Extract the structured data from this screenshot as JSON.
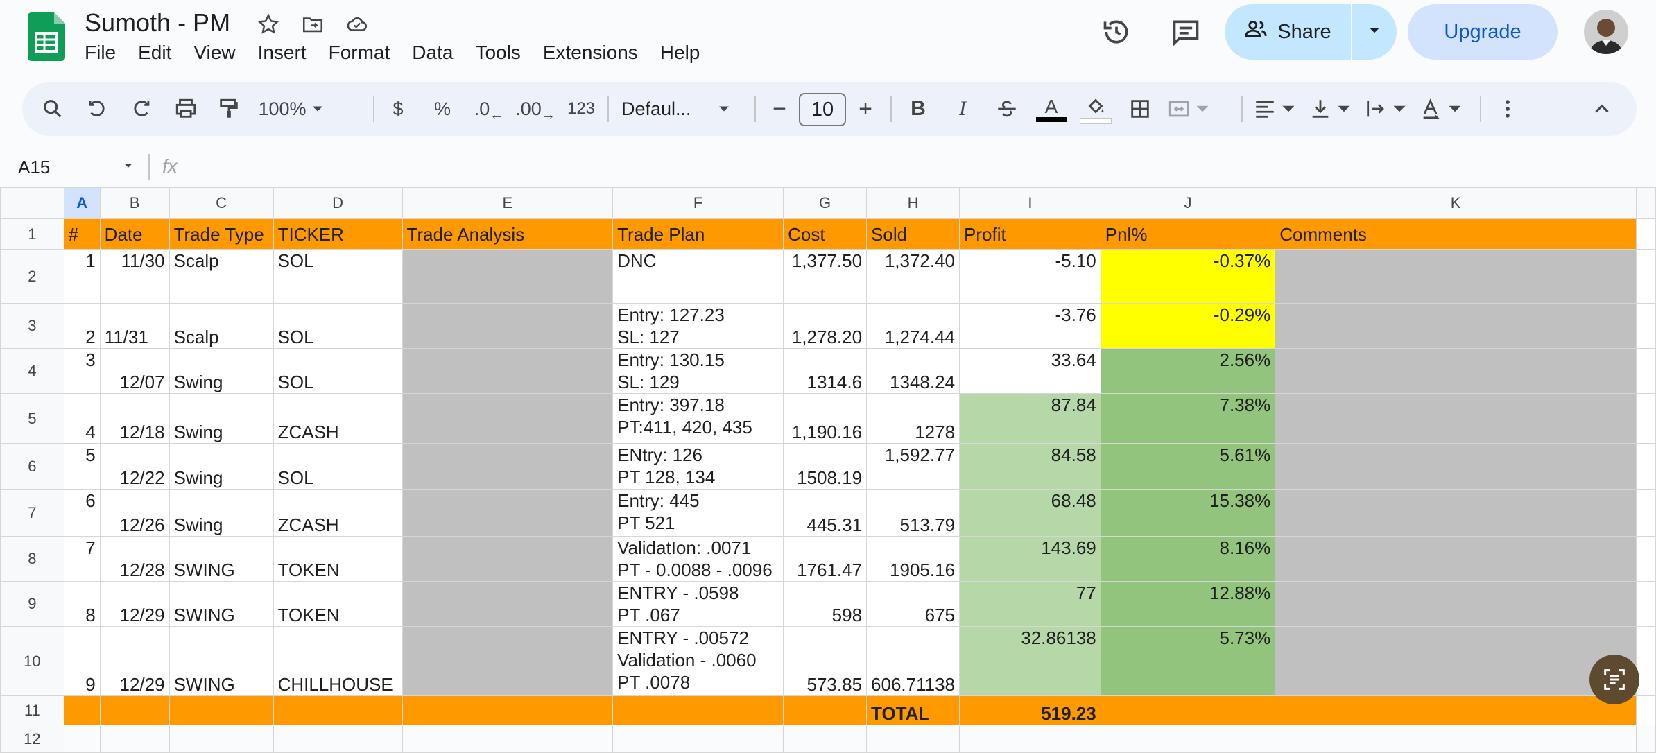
{
  "app": {
    "doc_title": "Sumoth - PM",
    "menu": [
      "File",
      "Edit",
      "View",
      "Insert",
      "Format",
      "Data",
      "Tools",
      "Extensions",
      "Help"
    ],
    "share_label": "Share",
    "upgrade_label": "Upgrade"
  },
  "toolbar": {
    "zoom": "100%",
    "currency": "$",
    "percent": "%",
    "dec_decrease": ".0",
    "dec_increase": ".00",
    "number_format": "123",
    "font": "Defaul...",
    "font_size": "10",
    "bold": "B",
    "italic": "I",
    "text_color": "A"
  },
  "formula_bar": {
    "name_box": "A15",
    "fx": "fx",
    "value": ""
  },
  "columns": [
    "A",
    "B",
    "C",
    "D",
    "E",
    "F",
    "G",
    "H",
    "I",
    "J",
    "K"
  ],
  "row_numbers": [
    "1",
    "2",
    "3",
    "4",
    "5",
    "6",
    "7",
    "8",
    "9",
    "10",
    "11",
    "12"
  ],
  "header": {
    "a": "#",
    "b": "Date",
    "c": "Trade Type",
    "d": "TICKER",
    "e": "Trade Analysis",
    "f": "Trade Plan",
    "g": "Cost",
    "h": "Sold",
    "i": "Profit",
    "j": "Pnl%",
    "k": "Comments"
  },
  "rows": [
    {
      "a": "1",
      "b": "11/30",
      "c": "Scalp",
      "d": "SOL",
      "f": [
        "DNC"
      ],
      "g": "1,377.50",
      "h": "1,372.40",
      "i": "-5.10",
      "j": "-0.37%"
    },
    {
      "a": "2",
      "b": "11/31",
      "c": "Scalp",
      "d": "SOL",
      "f": [
        "Entry:  127.23",
        "SL: 127"
      ],
      "g": "1,278.20",
      "h": "1,274.44",
      "i": "-3.76",
      "j": "-0.29%"
    },
    {
      "a": "3",
      "b": "12/07",
      "c": "Swing",
      "d": "SOL",
      "f": [
        "Entry: 130.15",
        "SL: 129"
      ],
      "g": "1314.6",
      "h": "1348.24",
      "i": "33.64",
      "j": "2.56%"
    },
    {
      "a": "4",
      "b": "12/18",
      "c": "Swing",
      "d": "ZCASH",
      "f": [
        "Entry: 397.18",
        "PT:411, 420, 435"
      ],
      "g": "1,190.16",
      "h": "1278",
      "i": "87.84",
      "j": "7.38%"
    },
    {
      "a": "5",
      "b": "12/22",
      "c": "Swing",
      "d": "SOL",
      "f": [
        "ENtry: 126",
        "PT 128, 134"
      ],
      "g": "1508.19",
      "h": "1,592.77",
      "i": "84.58",
      "j": "5.61%"
    },
    {
      "a": "6",
      "b": "12/26",
      "c": "Swing",
      "d": "ZCASH",
      "f": [
        "Entry: 445",
        "PT 521"
      ],
      "g": "445.31",
      "h": "513.79",
      "i": "68.48",
      "j": "15.38%"
    },
    {
      "a": "7",
      "b": "12/28",
      "c": "SWING",
      "d": "TOKEN",
      "f": [
        "ValidatIon: .0071",
        "PT - 0.0088 - .0096"
      ],
      "g": "1761.47",
      "h": "1905.16",
      "i": "143.69",
      "j": "8.16%"
    },
    {
      "a": "8",
      "b": "12/29",
      "c": "SWING",
      "d": "TOKEN",
      "f": [
        "ENTRY - .0598",
        "PT .067"
      ],
      "g": "598",
      "h": "675",
      "i": "77",
      "j": "12.88%"
    },
    {
      "a": "9",
      "b": "12/29",
      "c": "SWING",
      "d": "CHILLHOUSE",
      "f": [
        "ENTRY -  .00572",
        "Validation - .0060",
        "PT .0078"
      ],
      "g": "573.85",
      "h": "606.71138",
      "i": "32.86138",
      "j": "5.73%"
    }
  ],
  "total": {
    "label": "TOTAL",
    "value": "519.23"
  },
  "colors": {
    "header_bg": "#ff9900",
    "negative_pnl_bg": "#ffff00",
    "profit_bg": "#b6d7a8",
    "pnl_bg": "#93c47d",
    "analysis_bg": "#c0c0c0",
    "share_bg": "#c2e7ff",
    "upgrade_bg": "#d3e3fd"
  }
}
